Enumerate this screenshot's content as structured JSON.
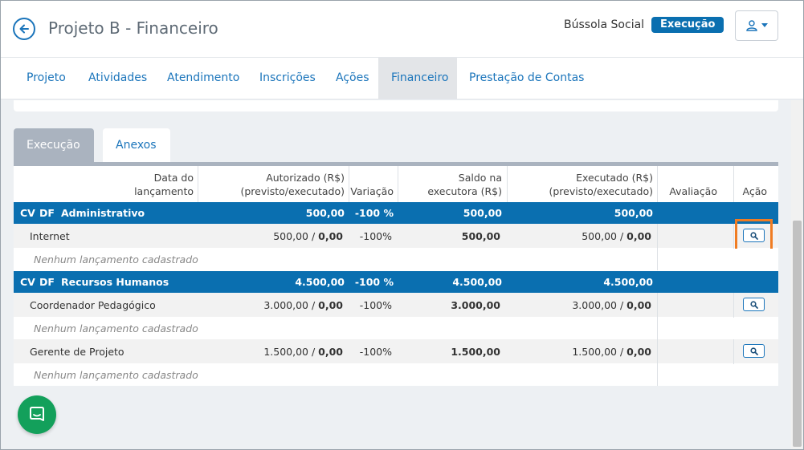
{
  "header": {
    "title": "Projeto B - Financeiro",
    "org": "Bússola Social",
    "status": "Execução"
  },
  "tabs": [
    {
      "label": "Projeto"
    },
    {
      "label": "Atividades"
    },
    {
      "label": "Atendimento"
    },
    {
      "label": "Inscrições"
    },
    {
      "label": "Ações"
    },
    {
      "label": "Financeiro",
      "active": true
    },
    {
      "label": "Prestação de Contas"
    }
  ],
  "subtabs": [
    {
      "label": "Execução",
      "active": true
    },
    {
      "label": "Anexos"
    }
  ],
  "table": {
    "headers": {
      "data": "Data do\nlançamento",
      "autorizado": "Autorizado (R$)\n(previsto/executado)",
      "variacao": "Variação",
      "saldo": "Saldo na\nexecutora (R$)",
      "executado": "Executado (R$)\n(previsto/executado)",
      "avaliacao": "Avaliação",
      "acao": "Ação"
    },
    "groups": [
      {
        "cv": "CV",
        "df": "DF",
        "name": "Administrativo",
        "autorizado": "500,00",
        "variacao": "-100 %",
        "saldo": "500,00",
        "executado": "500,00",
        "items": [
          {
            "name": "Internet",
            "aut_prev": "500,00",
            "aut_exec": "0,00",
            "variacao": "-100%",
            "saldo": "500,00",
            "exe_prev": "500,00",
            "exe_exec": "0,00",
            "empty": "Nenhum lançamento cadastrado"
          }
        ]
      },
      {
        "cv": "CV",
        "df": "DF",
        "name": "Recursos Humanos",
        "autorizado": "4.500,00",
        "variacao": "-100 %",
        "saldo": "4.500,00",
        "executado": "4.500,00",
        "items": [
          {
            "name": "Coordenador Pedagógico",
            "aut_prev": "3.000,00",
            "aut_exec": "0,00",
            "variacao": "-100%",
            "saldo": "3.000,00",
            "exe_prev": "3.000,00",
            "exe_exec": "0,00",
            "empty": "Nenhum lançamento cadastrado"
          },
          {
            "name": "Gerente de Projeto",
            "aut_prev": "1.500,00",
            "aut_exec": "0,00",
            "variacao": "-100%",
            "saldo": "1.500,00",
            "exe_prev": "1.500,00",
            "exe_exec": "0,00",
            "empty": "Nenhum lançamento cadastrado"
          }
        ]
      }
    ],
    "separator": " / "
  },
  "colors": {
    "brand": "#1b75bb",
    "group_row": "#0a6fb0",
    "highlight": "#f07c22",
    "chat": "#13a05b"
  },
  "icons": {
    "back": "arrow-left-icon",
    "user": "user-icon",
    "view": "magnifier-icon",
    "chat": "chat-icon"
  }
}
